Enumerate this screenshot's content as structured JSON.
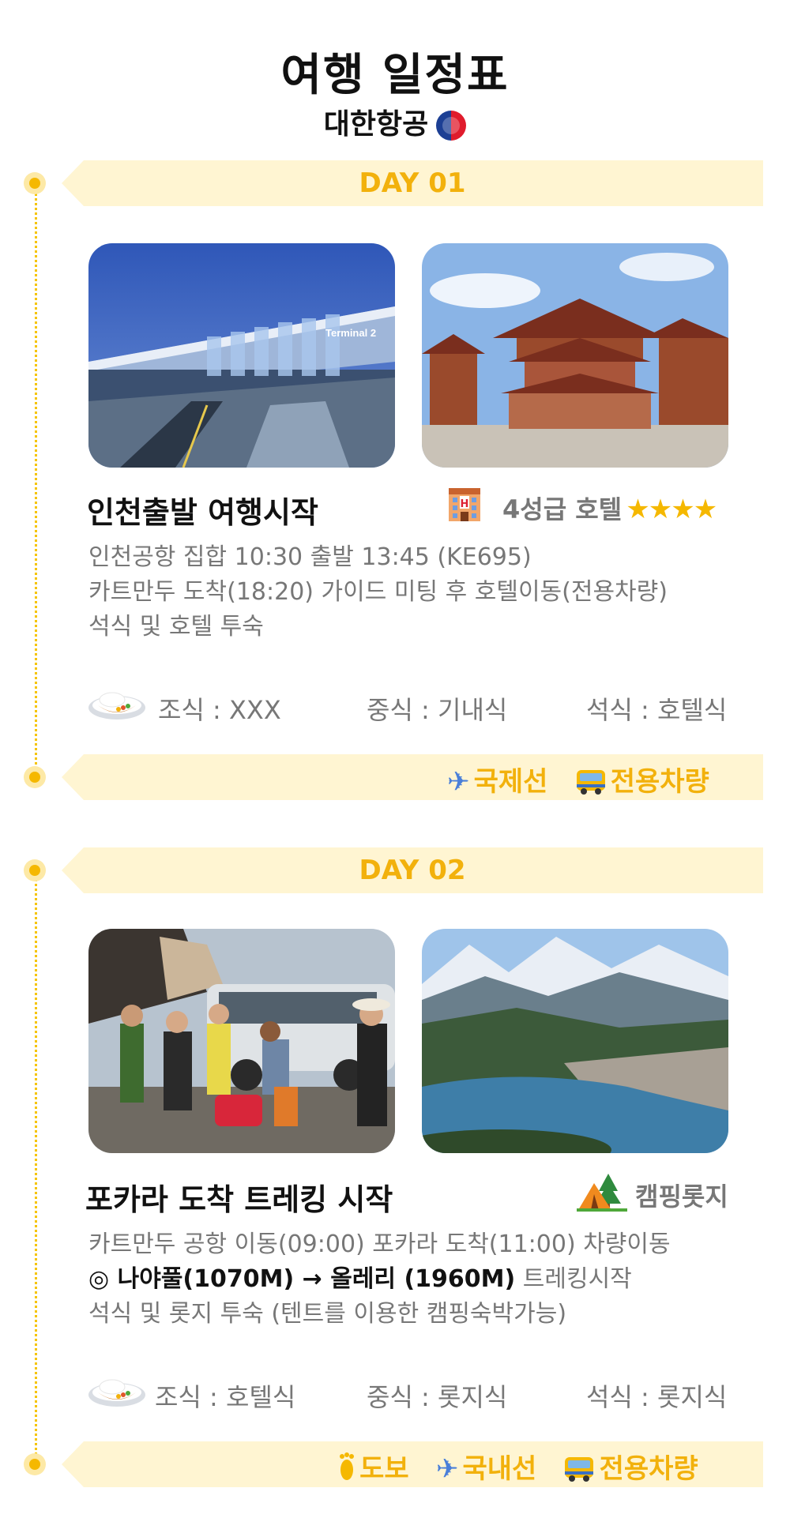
{
  "header": {
    "title": "여행 일정표",
    "airline": "대한항공"
  },
  "days": [
    {
      "label": "DAY 01",
      "heading": "인천출발 여행시작",
      "lodging_icon": "hotel-icon",
      "lodging": "4성급 호텔",
      "stars": "★★★★",
      "lines": [
        "인천공항 집합 10:30 출발 13:45 (KE695)",
        "카트만두 도착(18:20) 가이드 미팅 후 호텔이동(전용차량)",
        "석식 및 호텔 투숙"
      ],
      "meals": {
        "breakfast": "조식 : XXX",
        "lunch": "중식 : 기내식",
        "dinner": "석식 : 호텔식"
      },
      "transport": [
        {
          "icon": "airplane-icon",
          "label": "국제선"
        },
        {
          "icon": "bus-icon",
          "label": "전용차량"
        }
      ],
      "photo_labels": {
        "terminal_sign": "Terminal 2"
      }
    },
    {
      "label": "DAY 02",
      "heading": "포카라 도착 트레킹 시작",
      "lodging_icon": "camping-icon",
      "lodging": "캠핑롯지",
      "line1": "카트만두 공항 이동(09:00) 포카라 도착(11:00) 차량이동",
      "line2_bold": "◎ 나야풀(1070M)  → 올레리 (1960M)",
      "line2_rest": " 트레킹시작",
      "line3": "석식 및 롯지 투숙 (텐트를 이용한 캠핑숙박가능)",
      "meals": {
        "breakfast": "조식 : 호텔식",
        "lunch": "중식 : 롯지식",
        "dinner": "석식 : 롯지식"
      },
      "transport": [
        {
          "icon": "footprint-icon",
          "label": "도보"
        },
        {
          "icon": "airplane-icon",
          "label": "국내선"
        },
        {
          "icon": "bus-icon",
          "label": "전용차량"
        }
      ]
    }
  ],
  "colors": {
    "accent": "#f2b10c",
    "banner": "#fff5d2",
    "dot": "#f5b800"
  }
}
